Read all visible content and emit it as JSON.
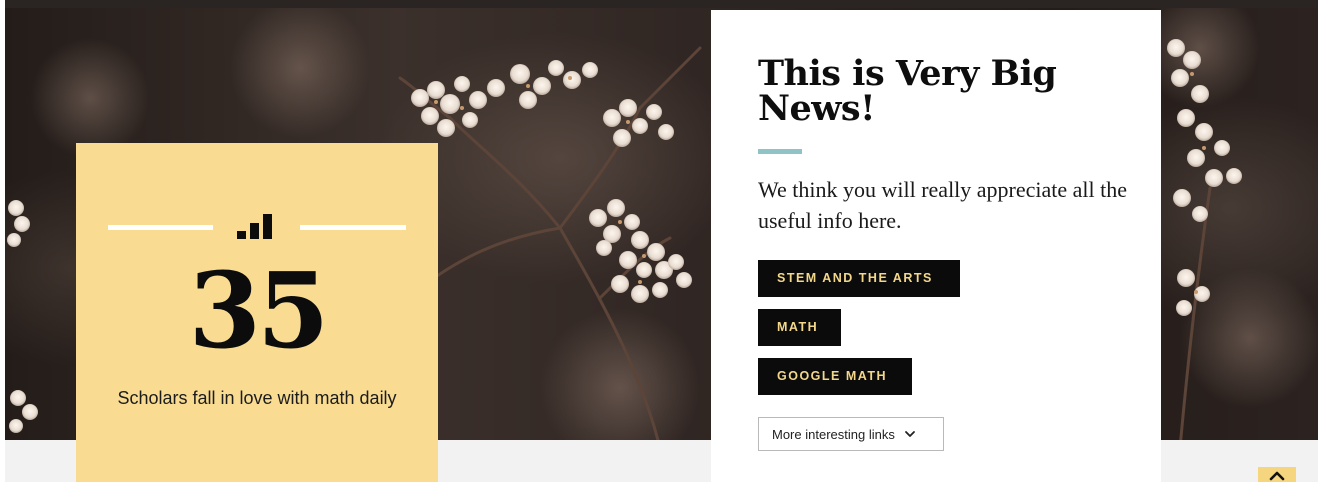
{
  "stat": {
    "number": "35",
    "caption": "Scholars fall in love with math daily",
    "icon": "bar-chart-icon"
  },
  "news": {
    "title": "This is Very Big News!",
    "body": "We think you will really appreciate all the useful info here.",
    "tags": [
      "STEM AND THE ARTS",
      "MATH",
      "GOOGLE MATH"
    ],
    "dropdown_label": "More interesting links"
  },
  "colors": {
    "card_yellow": "#f9dc91",
    "accent_teal": "#8ec4c6",
    "tag_background": "#0b0b0b",
    "tag_text": "#f3d78a"
  },
  "icons": {
    "dropdown": "chevron-down-icon",
    "back_to_top": "arrow-up-icon"
  }
}
